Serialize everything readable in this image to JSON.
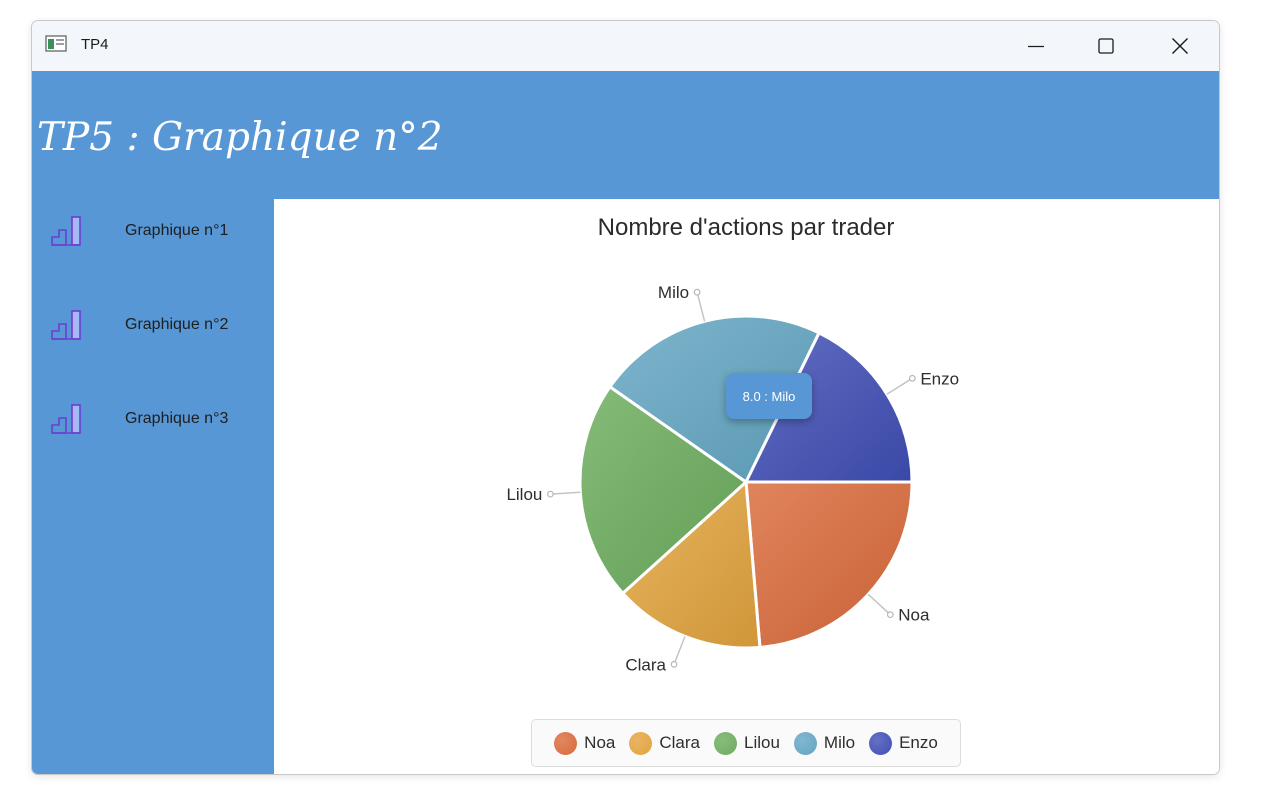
{
  "window": {
    "title": "TP4"
  },
  "header": {
    "title": "TP5 : Graphique n°2"
  },
  "sidebar": {
    "items": [
      {
        "label": "Graphique n°1",
        "icon": "bar-chart-icon"
      },
      {
        "label": "Graphique n°2",
        "icon": "bar-chart-icon"
      },
      {
        "label": "Graphique n°3",
        "icon": "bar-chart-icon"
      }
    ]
  },
  "colors": {
    "header_bg": "#5797d6",
    "Noa": "#d9693a",
    "Clara": "#e2a33d",
    "Lilou": "#6aac5c",
    "Milo": "#62a5c2",
    "Enzo": "#3f4eb5"
  },
  "tooltip": {
    "text": "8.0 : Milo"
  },
  "chart_data": {
    "type": "pie",
    "title": "Nombre d'actions par trader",
    "labels": [
      "Noa",
      "Clara",
      "Lilou",
      "Milo",
      "Enzo"
    ],
    "values": [
      8.4,
      5.2,
      7.6,
      8.0,
      6.3
    ],
    "start_angle_deg": 0,
    "direction": "clockwise",
    "legend": "bottom"
  }
}
